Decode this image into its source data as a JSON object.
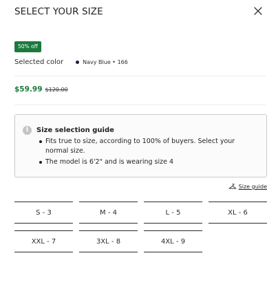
{
  "header": {
    "title": "SELECT YOUR SIZE",
    "close_icon": "close-icon"
  },
  "badge": {
    "label": "50% off",
    "color": "#1b7a3d"
  },
  "color": {
    "label": "Selected color",
    "value": "Navy Blue • 166",
    "swatch": "#1a1f3a"
  },
  "price": {
    "current": "$59.99",
    "original": "$120.00",
    "accent": "#1b7a3d"
  },
  "guide": {
    "icon": "info-icon",
    "title": "Size selection guide",
    "items": [
      "Fits true to size, according to 100% of buyers. Select your normal size.",
      "The model is 6'2\" and is wearing size 4"
    ]
  },
  "size_guide_link": {
    "icon": "hanger-icon",
    "label": "Size guide"
  },
  "sizes": [
    "S - 3",
    "M - 4",
    "L - 5",
    "XL - 6",
    "XXL - 7",
    "3XL - 8",
    "4XL - 9"
  ]
}
